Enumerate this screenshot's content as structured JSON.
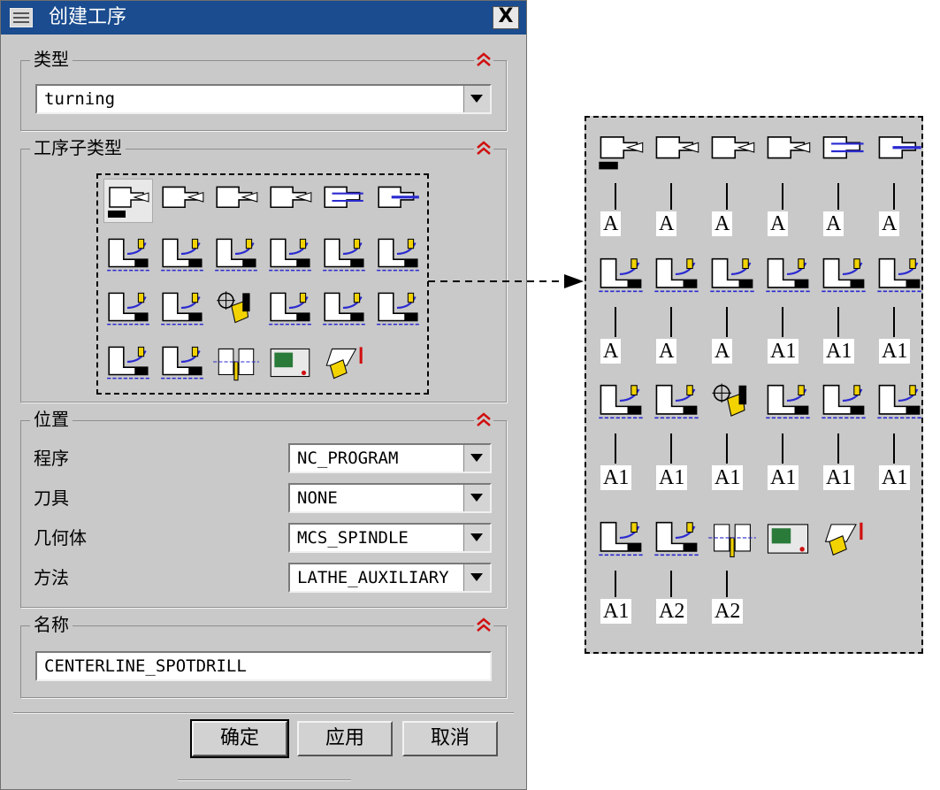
{
  "window": {
    "title": "创建工序",
    "close_label": "X"
  },
  "type_group": {
    "title": "类型",
    "value": "turning"
  },
  "subtype_group": {
    "title": "工序子类型"
  },
  "location_group": {
    "title": "位置",
    "rows": [
      {
        "label": "程序",
        "value": "NC_PROGRAM"
      },
      {
        "label": "刀具",
        "value": "NONE"
      },
      {
        "label": "几何体",
        "value": "MCS_SPINDLE"
      },
      {
        "label": "方法",
        "value": "LATHE_AUXILIARY"
      }
    ]
  },
  "name_group": {
    "title": "名称",
    "value": "CENTERLINE_SPOTDRILL"
  },
  "buttons": {
    "ok": "确定",
    "apply": "应用",
    "cancel": "取消"
  },
  "subtype_icons": [
    [
      "centerline-spotdrill",
      "centerline-drilling",
      "centerline-peckdrill",
      "centerline-breakchip",
      "centerline-reaming",
      "centerline-tapping"
    ],
    [
      "facing",
      "rough-turn-od",
      "rough-back-turn",
      "rough-bore-id",
      "rough-back-bore",
      "finish-turn-od"
    ],
    [
      "finish-bore-id",
      "finish-back-bore",
      "teach-mode",
      "groove-od",
      "groove-id",
      "groove-face"
    ],
    [
      "thread-od",
      "thread-id",
      "partoff",
      "lathe-control",
      "lathe-user"
    ]
  ],
  "annotation_labels": [
    [
      "A",
      "A",
      "A",
      "A",
      "A",
      "A"
    ],
    [
      "A",
      "A",
      "A",
      "A1",
      "A1",
      "A1"
    ],
    [
      "A1",
      "A1",
      "A1",
      "A1",
      "A1",
      "A1"
    ],
    [
      "A1",
      "A2",
      "A2"
    ]
  ],
  "colors": {
    "titlebar": "#1a4c8f",
    "dialog": "#c9c9c9",
    "icon_yellow": "#f2d300",
    "icon_blue": "#2a2ad0",
    "collapse_red": "#d01010"
  }
}
